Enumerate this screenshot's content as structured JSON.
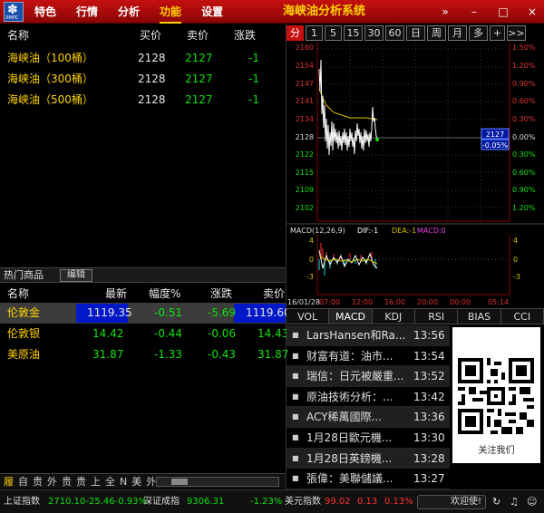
{
  "header": {
    "logo_text": "XMPC",
    "menu": [
      "特色",
      "行情",
      "分析",
      "功能",
      "设置"
    ],
    "active_menu_index": 3,
    "app_title": "海峡油分析系统",
    "window_controls": [
      "»",
      "–",
      "□",
      "×"
    ]
  },
  "quote_table": {
    "columns": [
      "名称",
      "买价",
      "卖价",
      "涨跌"
    ],
    "rows": [
      {
        "name": "海峡油（100桶）",
        "bid": "2128",
        "ask": "2127",
        "change": "-1"
      },
      {
        "name": "海峡油（300桶）",
        "bid": "2128",
        "ask": "2127",
        "change": "-1"
      },
      {
        "name": "海峡油（500桶）",
        "bid": "2128",
        "ask": "2127",
        "change": "-1"
      }
    ]
  },
  "hot_products": {
    "label": "热门商品",
    "edit_label": "编辑",
    "columns": [
      "名称",
      "最新",
      "幅度%",
      "涨跌",
      "卖价"
    ],
    "rows": [
      {
        "name": "伦敦金",
        "last": "1119.35",
        "pct": "-0.51",
        "change": "-5.69",
        "ask": "1119.60"
      },
      {
        "name": "伦敦银",
        "last": "14.42",
        "pct": "-0.44",
        "change": "-0.06",
        "ask": "14.43"
      },
      {
        "name": "美原油",
        "last": "31.87",
        "pct": "-1.33",
        "change": "-0.43",
        "ask": "31.87"
      }
    ]
  },
  "bottom_tabs": [
    "履",
    "自",
    "贵",
    "外",
    "贵",
    "贵",
    "上",
    "全",
    "N",
    "美",
    "外"
  ],
  "period_tabs": [
    "分",
    "1",
    "5",
    "15",
    "30",
    "60",
    "日",
    "周",
    "月",
    "多",
    "+",
    ">>"
  ],
  "active_period_index": 0,
  "chart": {
    "price_labels": [
      "2160",
      "2154",
      "2147",
      "2141",
      "2134",
      "2128",
      "2122",
      "2115",
      "2109",
      "2102"
    ],
    "pct_labels": [
      "1.50%",
      "1.20%",
      "0.90%",
      "0.60%",
      "0.30%",
      "0.00%",
      "0.30%",
      "0.60%",
      "0.90%",
      "1.20%"
    ],
    "current_price": "2127",
    "current_pct": "-0.05%",
    "macd_title": "MACD(12,26,9)",
    "macd_dif": "DIF:-1",
    "macd_dea": "DEA:-1",
    "macd_macd": "MACD:0",
    "macd_ticks": [
      "4",
      "0",
      "-3"
    ],
    "date_label": "16/01/28",
    "time_labels": [
      "07:00",
      "12:00",
      "16:00",
      "20:00",
      "00:00",
      "05:14"
    ]
  },
  "indicator_tabs": [
    "VOL",
    "MACD",
    "KDJ",
    "RSI",
    "BIAS",
    "CCI"
  ],
  "active_indicator_index": 1,
  "news": [
    {
      "title": "LarsHansen和Ra...",
      "time": "13:56"
    },
    {
      "title": "财富有道：油市...",
      "time": "13:54"
    },
    {
      "title": "瑞信：日元被嚴重...",
      "time": "13:52"
    },
    {
      "title": "原油技術分析：...",
      "time": "13:42"
    },
    {
      "title": "ACY稀萬國際...",
      "time": "13:36"
    },
    {
      "title": "1月28日歐元機...",
      "time": "13:30"
    },
    {
      "title": "1月28日英鎊機...",
      "time": "13:28"
    },
    {
      "title": "張偉：美聯儲議...",
      "time": "13:27"
    }
  ],
  "qr_caption": "关注我们",
  "status_bar": {
    "sh_label": "上证指数",
    "sh_value": "2710.10-25.46-0.93%",
    "sz_label": "深证成指",
    "sz_value": "9306.31",
    "sz_pct": "-1.23%",
    "usd_label": "美元指数",
    "usd_value": "99.02",
    "usd_change": "0.13",
    "usd_pct": "0.13%",
    "welcome": "欢迎使!"
  },
  "colors": {
    "accent": "#c81010",
    "up": "#ff3030",
    "down": "#10e010",
    "name": "#ffd200"
  }
}
